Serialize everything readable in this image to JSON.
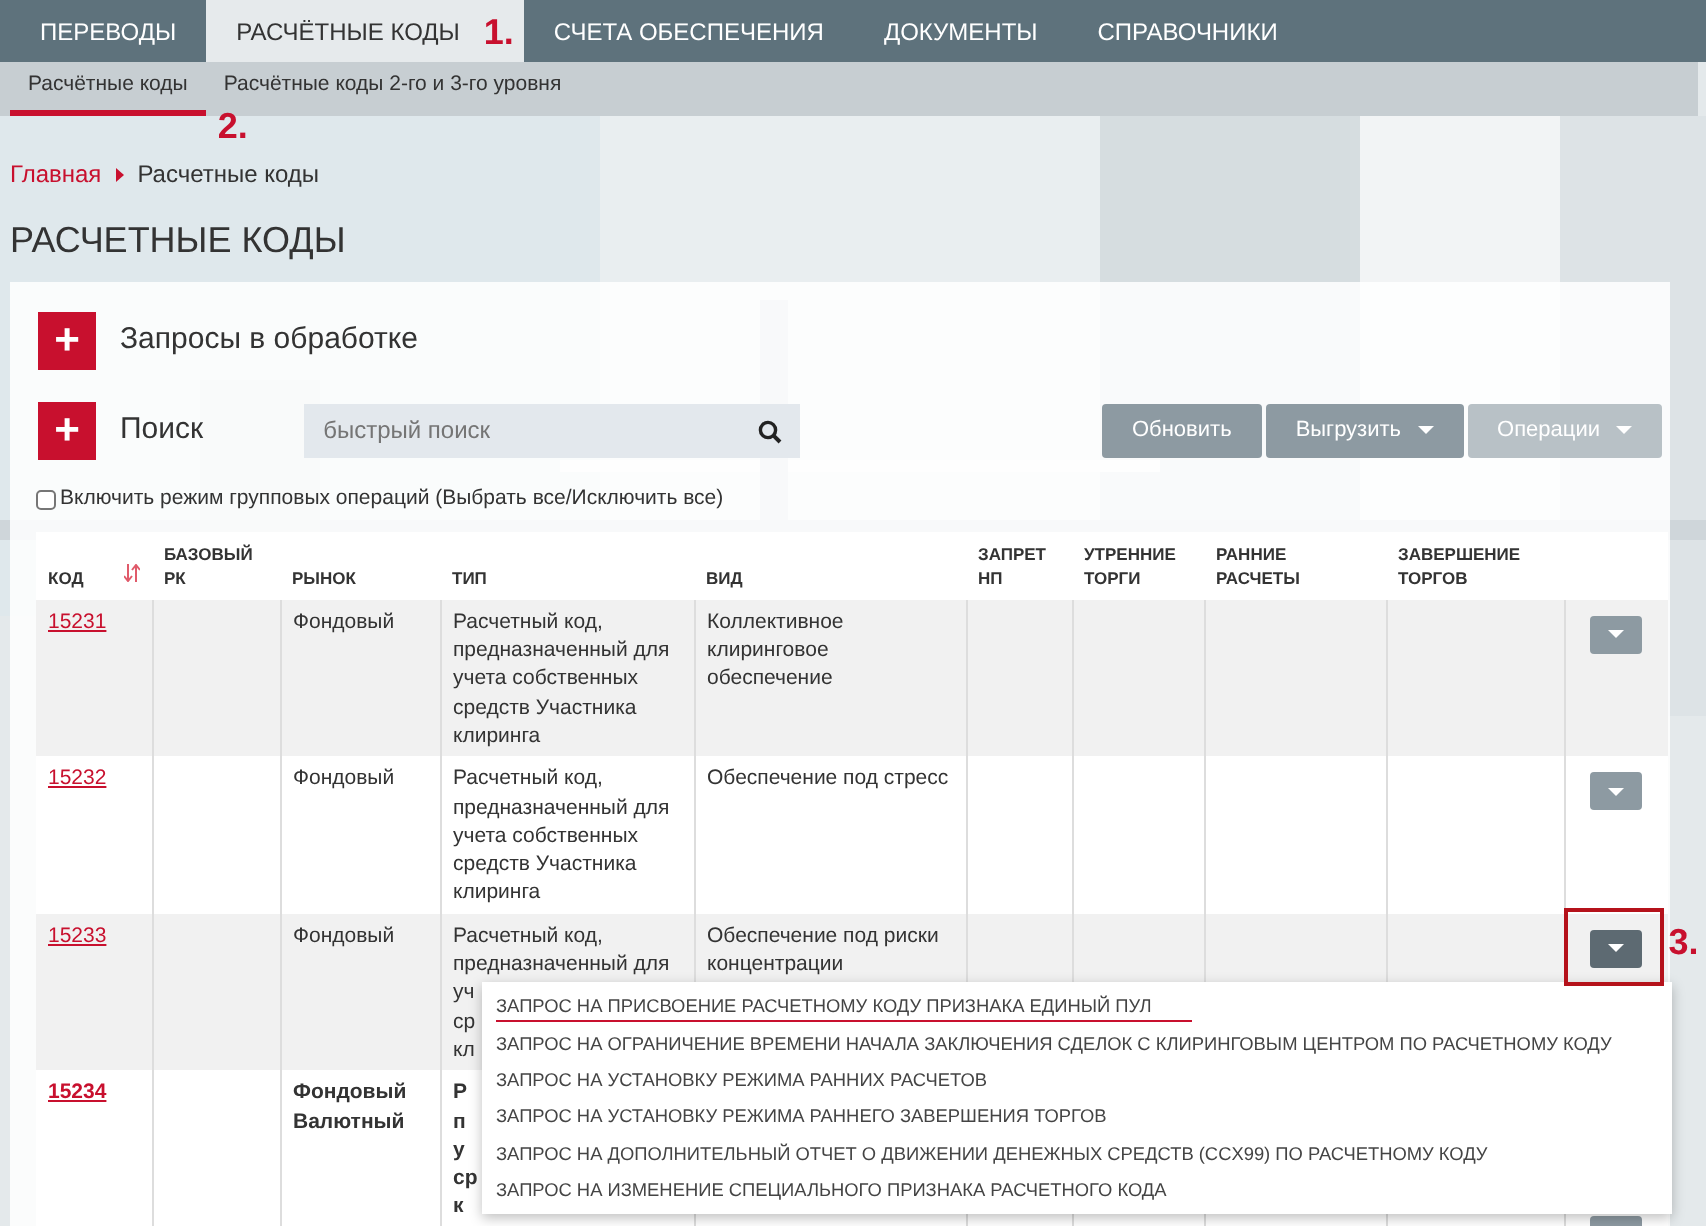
{
  "top_nav": [
    {
      "label": "ПЕРЕВОДЫ",
      "selected": false
    },
    {
      "label": "РАСЧЁТНЫЕ КОДЫ",
      "selected": true
    },
    {
      "label": "СЧЕТА ОБЕСПЕЧЕНИЯ",
      "selected": false
    },
    {
      "label": "ДОКУМЕНТЫ",
      "selected": false
    },
    {
      "label": "СПРАВОЧНИКИ",
      "selected": false
    }
  ],
  "sub_nav": [
    {
      "label": "Расчётные коды",
      "selected": true
    },
    {
      "label": "Расчётные коды 2-го и 3-го уровня",
      "selected": false
    }
  ],
  "breadcrumb": [
    "Главная",
    "Расчетные коды"
  ],
  "page_title": "РАСЧЕТНЫЕ КОДЫ",
  "sections": [
    {
      "label": "Запросы в обработке",
      "icon_text": "+"
    },
    {
      "label": "Поиск",
      "icon_text": "+"
    }
  ],
  "search": {
    "placeholder": "быстрый поиск"
  },
  "toolbar": [
    {
      "label": "Обновить",
      "kind": "plain",
      "disabled": false
    },
    {
      "label": "Выгрузить",
      "kind": "dropdown",
      "disabled": false
    },
    {
      "label": "Операции",
      "kind": "dropdown",
      "disabled": true
    }
  ],
  "group_mode": {
    "label": "Включить режим групповых операций (Выбрать все/Исключить все)",
    "checked": false
  },
  "table": {
    "columns": [
      "КОД",
      "БАЗОВЫЙ РК",
      "РЫНОК",
      "ТИП",
      "ВИД",
      "ЗАПРЕТ НП",
      "УТРЕННИЕ ТОРГИ",
      "РАННИЕ РАСЧЕТЫ",
      "ЗАВЕРШЕНИЕ ТОРГОВ"
    ],
    "rows": [
      {
        "code": "15231",
        "market": [
          "Фондовый"
        ],
        "type": [
          "Расчетный код,",
          "предназначенный для",
          "учета собственных",
          "средств Участника",
          "клиринга"
        ],
        "kind": [
          "Коллективное",
          "клиринговое",
          "обеспечение"
        ],
        "bold": false,
        "menu_open": false
      },
      {
        "code": "15232",
        "market": [
          "Фондовый"
        ],
        "type": [
          "Расчетный код,",
          "предназначенный для",
          "учета собственных",
          "средств Участника",
          "клиринга"
        ],
        "kind": [
          "Обеспечение под стресс"
        ],
        "bold": false,
        "menu_open": false
      },
      {
        "code": "15233",
        "market": [
          "Фондовый"
        ],
        "type": [
          "Расчетный код,",
          "предназначенный для",
          "уч",
          "ср",
          "кл"
        ],
        "kind": [
          "Обеспечение под риски",
          "концентрации"
        ],
        "bold": false,
        "menu_open": true
      },
      {
        "code": "15234",
        "market": [
          "Фондовый",
          "Валютный"
        ],
        "type": [
          "Р",
          "п",
          "у",
          "ср",
          "к"
        ],
        "bold": true,
        "menu_open": false
      }
    ]
  },
  "row_menu": [
    {
      "label": "ЗАПРОС НА ПРИСВОЕНИЕ РАСЧЕТНОМУ КОДУ ПРИЗНАКА ЕДИНЫЙ ПУЛ",
      "selected": true
    },
    {
      "label": "ЗАПРОС НА ОГРАНИЧЕНИЕ ВРЕМЕНИ НАЧАЛА ЗАКЛЮЧЕНИЯ СДЕЛОК С КЛИРИНГОВЫМ ЦЕНТРОМ ПО РАСЧЕТНОМУ КОДУ",
      "selected": false
    },
    {
      "label": "ЗАПРОС НА УСТАНОВКУ РЕЖИМА РАННИХ РАСЧЕТОВ",
      "selected": false
    },
    {
      "label": "ЗАПРОС НА УСТАНОВКУ РЕЖИМА РАННЕГО ЗАВЕРШЕНИЯ ТОРГОВ",
      "selected": false
    },
    {
      "label": "ЗАПРОС НА ДОПОЛНИТЕЛЬНЫЙ ОТЧЕТ О ДВИЖЕНИИ ДЕНЕЖНЫХ СРЕДСТВ (CCX99) ПО РАСЧЕТНОМУ КОДУ",
      "selected": false
    },
    {
      "label": "ЗАПРОС НА ИЗМЕНЕНИЕ СПЕЦИАЛЬНОГО ПРИЗНАКА РАСЧЕТНОГО КОДА",
      "selected": false
    }
  ],
  "annotations": [
    {
      "label": "1.",
      "kind": "number"
    },
    {
      "label": "2.",
      "kind": "number"
    },
    {
      "label": "3.",
      "kind": "boxed"
    }
  ]
}
